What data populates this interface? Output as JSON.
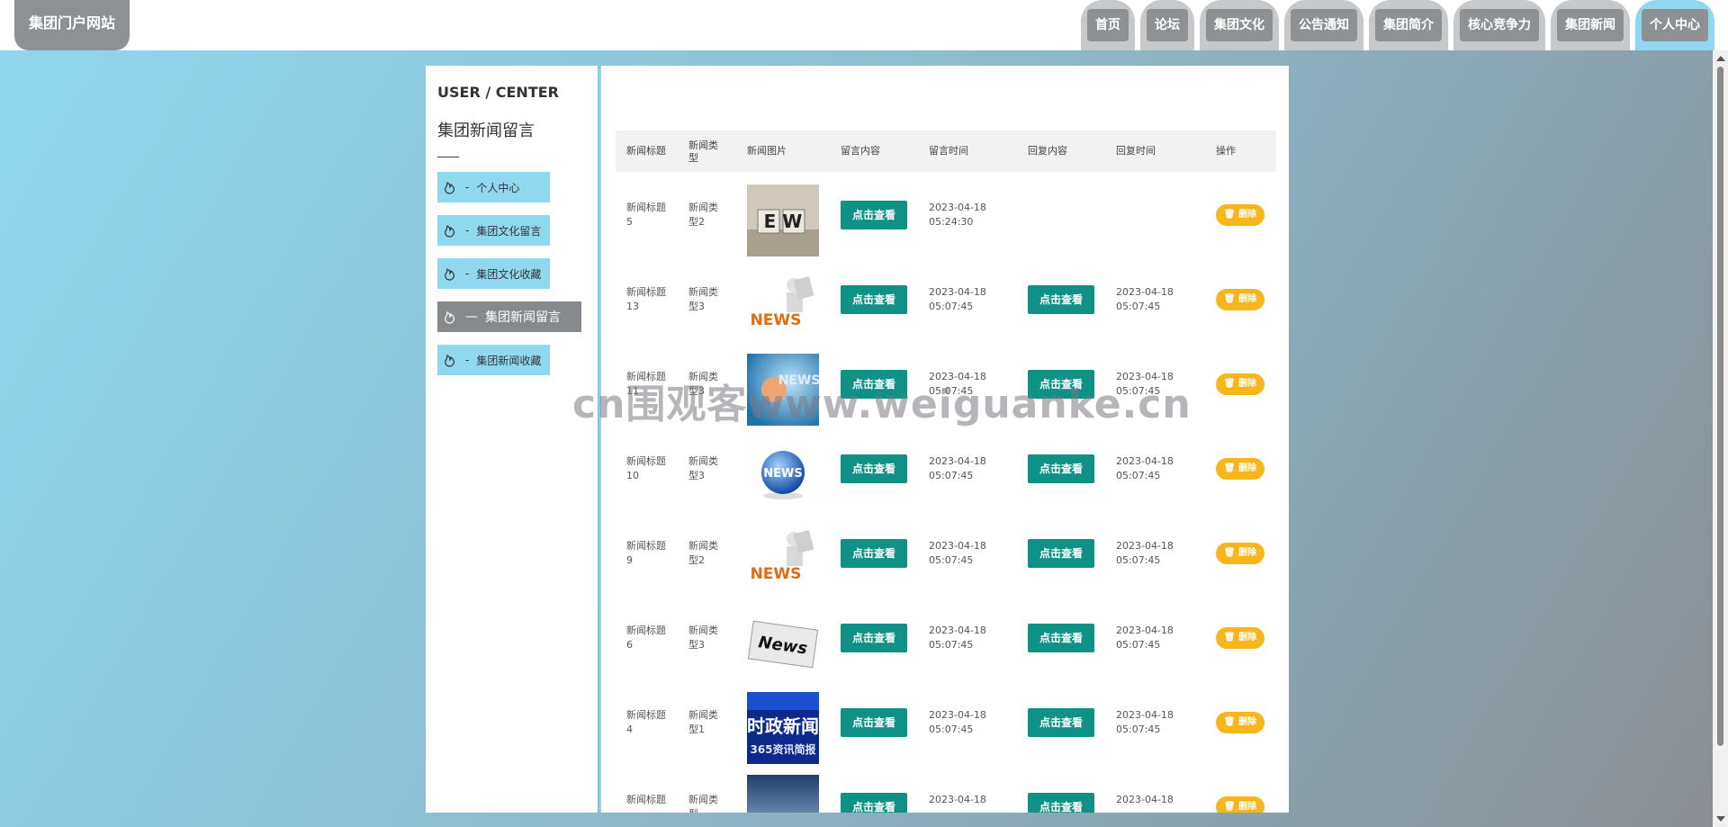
{
  "site_title": "集团门户网站",
  "nav": [
    "首页",
    "论坛",
    "集团文化",
    "公告通知",
    "集团简介",
    "核心竞争力",
    "集团新闻",
    "个人中心"
  ],
  "nav_active": "个人中心",
  "sidebar": {
    "title": "USER / CENTER",
    "subtitle": "集团新闻留言",
    "items": [
      {
        "label": "个人中心",
        "prefix": "-"
      },
      {
        "label": "集团文化留言",
        "prefix": "-"
      },
      {
        "label": "集团文化收藏",
        "prefix": "-"
      },
      {
        "label": "集团新闻留言",
        "prefix": "—"
      },
      {
        "label": "集团新闻收藏",
        "prefix": "-"
      }
    ],
    "active_index": 3
  },
  "table": {
    "headers": [
      "新闻标题",
      "新闻类型",
      "新闻图片",
      "留言内容",
      "留言时间",
      "回复内容",
      "回复时间",
      "操作"
    ],
    "view_label": "点击查看",
    "delete_label": "删除",
    "rows": [
      {
        "title": "新闻标题5",
        "type": "新闻类型2",
        "image": "letters-blocks",
        "time": "2023-04-18 05:24:30",
        "reply_time": ""
      },
      {
        "title": "新闻标题13",
        "type": "新闻类型3",
        "image": "news-figure",
        "time": "2023-04-18 05:07:45",
        "reply_time": "2023-04-18 05:07:45"
      },
      {
        "title": "新闻标题11",
        "type": "新闻类型3",
        "image": "news-blue",
        "time": "2023-04-18 05:07:45",
        "reply_time": "2023-04-18 05:07:45"
      },
      {
        "title": "新闻标题10",
        "type": "新闻类型3",
        "image": "news-globe",
        "time": "2023-04-18 05:07:45",
        "reply_time": "2023-04-18 05:07:45"
      },
      {
        "title": "新闻标题9",
        "type": "新闻类型2",
        "image": "news-figure",
        "time": "2023-04-18 05:07:45",
        "reply_time": "2023-04-18 05:07:45"
      },
      {
        "title": "新闻标题6",
        "type": "新闻类型3",
        "image": "news-paper",
        "time": "2023-04-18 05:07:45",
        "reply_time": "2023-04-18 05:07:45"
      },
      {
        "title": "新闻标题4",
        "type": "新闻类型1",
        "image": "finance-news",
        "time": "2023-04-18 05:07:45",
        "reply_time": "2023-04-18 05:07:45"
      },
      {
        "title": "新闻标题",
        "type": "新闻类型",
        "image": "news-sky",
        "time": "2023-04-18",
        "reply_time": "2023-04-18"
      }
    ]
  },
  "image_text": {
    "letters": "E W",
    "news": "NEWS",
    "news_alt": "News",
    "finance_line1": "时政新闻",
    "finance_line2": "365资讯简报"
  },
  "watermark": "cn围观客www.weiguanke.cn"
}
